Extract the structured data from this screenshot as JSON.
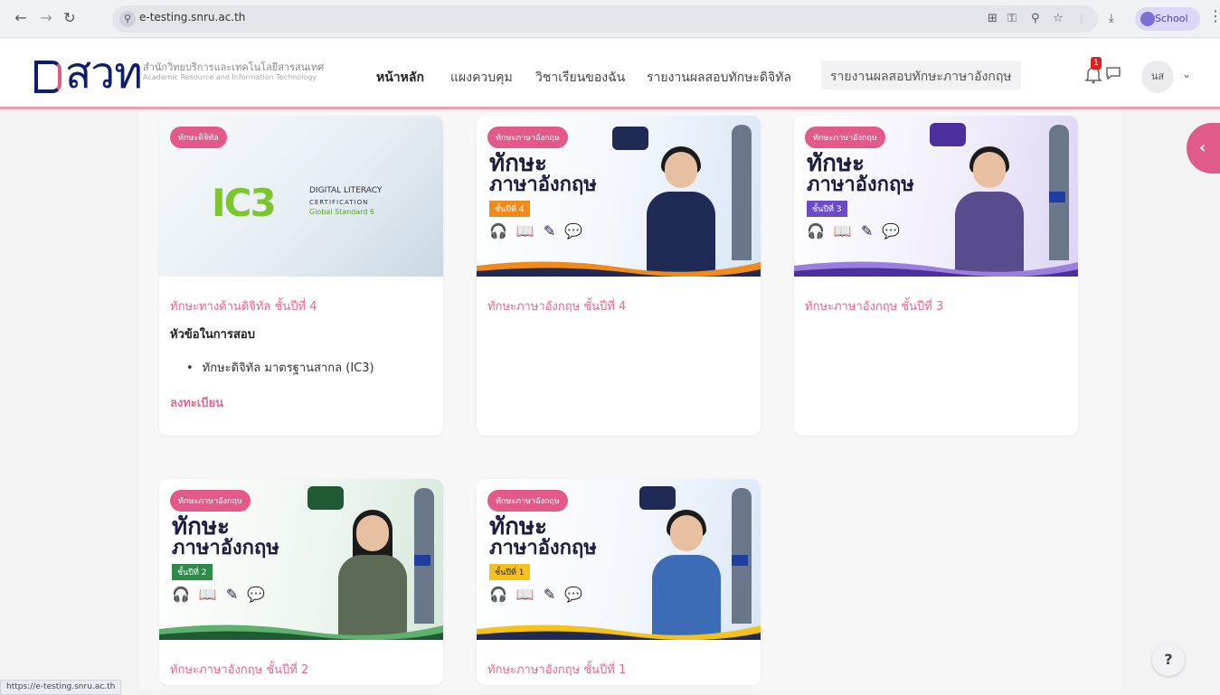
{
  "browser": {
    "url": "e-testing.snru.ac.th",
    "profile_label": "School"
  },
  "header": {
    "logo_text": "สวท",
    "logo_subtitle_th": "สำนักวิทยบริการและเทคโนโลยีสารสนเทศ",
    "logo_subtitle_en": "Academic Resource and Information Technology",
    "nav": [
      {
        "label": "หน้าหลัก"
      },
      {
        "label": "แผงควบคุม"
      },
      {
        "label": "วิชาเรียนของฉัน"
      },
      {
        "label": "รายงานผลสอบทักษะดิจิทัล"
      },
      {
        "label": "รายงานผลสอบทักษะภาษาอังกฤษ"
      }
    ],
    "notification_count": "1",
    "avatar_initials": "นส"
  },
  "courses": [
    {
      "tag": "ทักษะดิจิทัล",
      "title": "ทักษะทางด้านดิจิทัล ชั้นปีที่ 4",
      "subheading": "หัวข้อในการสอบ",
      "bullet": "ทักษะดิจิทัล มาตรฐานสากล (IC3)",
      "enroll_label": "ลงทะเบียน",
      "image": {
        "brand": "IC3",
        "line1": "DIGITAL LITERACY",
        "line2": "CERTIFICATION",
        "line3": "Global Standard 6"
      }
    },
    {
      "tag": "ทักษะภาษาอังกฤษ",
      "title": "ทักษะภาษาอังกฤษ ชั้นปีที่ 4",
      "image": {
        "headline1": "ทักษะ",
        "headline2": "ภาษาอังกฤษ",
        "grade": "ชั้นปีที่ 4",
        "accent": "#f08a1c"
      }
    },
    {
      "tag": "ทักษะภาษาอังกฤษ",
      "title": "ทักษะภาษาอังกฤษ ชั้นปีที่ 3",
      "image": {
        "headline1": "ทักษะ",
        "headline2": "ภาษาอังกฤษ",
        "grade": "ชั้นปีที่ 3",
        "accent": "#6b4cc4"
      }
    },
    {
      "tag": "ทักษะภาษาอังกฤษ",
      "title": "ทักษะภาษาอังกฤษ ชั้นปีที่ 2",
      "image": {
        "headline1": "ทักษะ",
        "headline2": "ภาษาอังกฤษ",
        "grade": "ชั้นปีที่ 2",
        "accent": "#2f8a4a"
      }
    },
    {
      "tag": "ทักษะภาษาอังกฤษ",
      "title": "ทักษะภาษาอังกฤษ ชั้นปีที่ 1",
      "image": {
        "headline1": "ทักษะ",
        "headline2": "ภาษาอังกฤษ",
        "grade": "ชั้นปีที่ 1",
        "accent": "#f4c21a"
      }
    }
  ],
  "help_label": "?",
  "status_url": "https://e-testing.snru.ac.th",
  "colors": {
    "accent_pink": "#e05a8a",
    "logo_navy": "#0f1f6e"
  }
}
